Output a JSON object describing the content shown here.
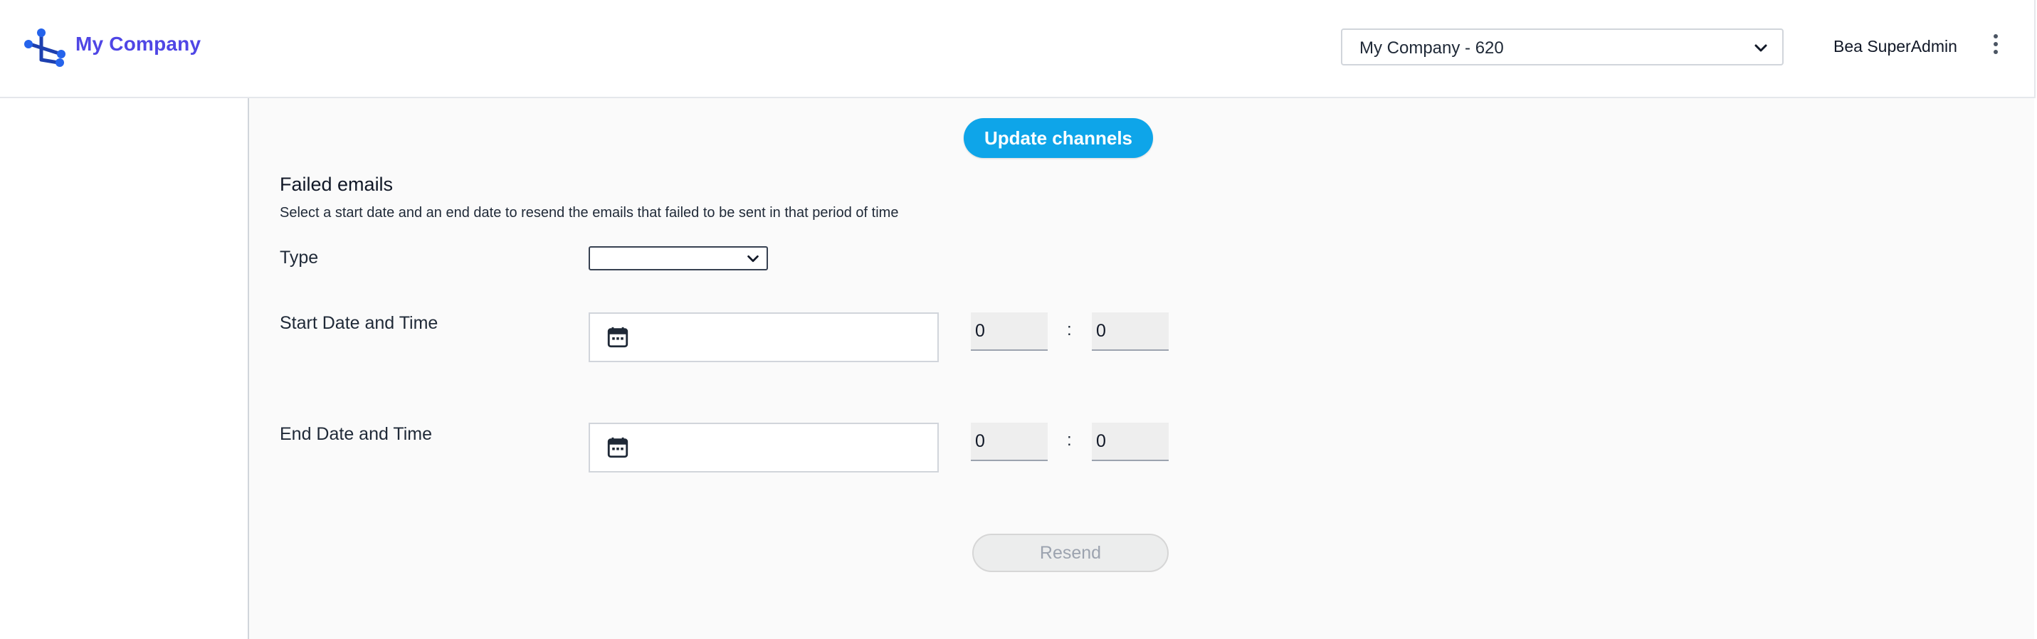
{
  "header": {
    "brand": "My Company",
    "company_select": {
      "selected": "My Company - 620"
    },
    "user_name": "Bea SuperAdmin",
    "logo_icon": "network-share-icon",
    "menu_icon": "more-vertical-icon"
  },
  "main": {
    "update_channels_label": "Update channels",
    "failed_emails": {
      "title": "Failed emails",
      "description": "Select a start date and an end date to resend the emails that failed to be sent in that period of time",
      "type_label": "Type",
      "type_selected": "",
      "start_label": "Start Date and Time",
      "start_date": "",
      "start_hour": "0",
      "start_minute": "0",
      "end_label": "End Date and Time",
      "end_date": "",
      "end_hour": "0",
      "end_minute": "0",
      "time_separator": ":",
      "resend_label": "Resend"
    }
  },
  "colors": {
    "brand": "#4f46e5",
    "primary_button": "#0ea5e9",
    "disabled_button": "#eceded"
  }
}
